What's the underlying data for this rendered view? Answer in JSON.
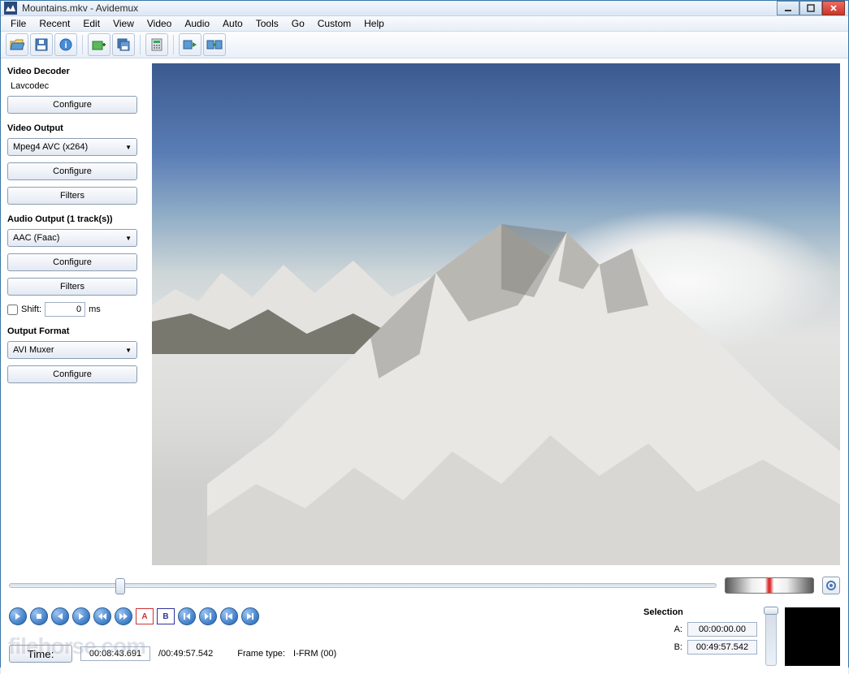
{
  "window": {
    "title": "Mountains.mkv - Avidemux"
  },
  "menu": [
    "File",
    "Recent",
    "Edit",
    "View",
    "Video",
    "Audio",
    "Auto",
    "Tools",
    "Go",
    "Custom",
    "Help"
  ],
  "toolbar": {
    "icons": [
      "open",
      "save",
      "info",
      "folder",
      "save-all",
      "calc",
      "play-filtered",
      "play-output"
    ]
  },
  "sidebar": {
    "decoder": {
      "title": "Video Decoder",
      "value": "Lavcodec",
      "configure": "Configure"
    },
    "video_out": {
      "title": "Video Output",
      "codec": "Mpeg4 AVC (x264)",
      "configure": "Configure",
      "filters": "Filters"
    },
    "audio_out": {
      "title": "Audio Output (1 track(s))",
      "codec": "AAC (Faac)",
      "configure": "Configure",
      "filters": "Filters",
      "shift_label": "Shift:",
      "shift_val": "0",
      "shift_unit": "ms"
    },
    "format": {
      "title": "Output Format",
      "muxer": "AVI Muxer",
      "configure": "Configure"
    }
  },
  "bottom": {
    "time_btn": "Time:",
    "time_current": "00:08:43.691",
    "time_total": "/00:49:57.542",
    "frame_type_label": "Frame type:",
    "frame_type": "I-FRM (00)",
    "selection": {
      "title": "Selection",
      "a_label": "A:",
      "a": "00:00:00.00",
      "b_label": "B:",
      "b": "00:49:57.542"
    }
  },
  "watermark": "filehorse.com"
}
